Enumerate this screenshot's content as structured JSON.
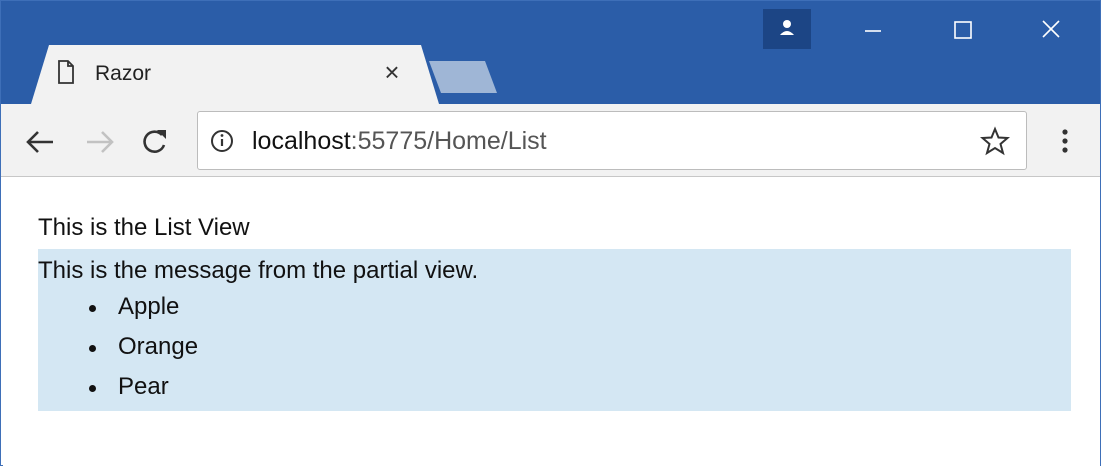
{
  "browser": {
    "tab": {
      "title": "Razor",
      "close_glyph": "×"
    },
    "address": {
      "host": "localhost",
      "rest": ":55775/Home/List"
    },
    "colors": {
      "titlebar": "#2b5da8",
      "toolbar": "#f2f2f2",
      "partial_background": "#d4e7f3"
    }
  },
  "icons": [
    "page-icon",
    "close-icon",
    "new-tab-icon",
    "profile-icon",
    "minimize-icon",
    "maximize-icon",
    "window-close-icon",
    "back-arrow-icon",
    "forward-arrow-icon",
    "reload-icon",
    "info-icon",
    "star-icon",
    "menu-dots-icon"
  ],
  "page": {
    "view_title": "This is the List View",
    "partial_message": "This is the message from the partial view.",
    "items": [
      "Apple",
      "Orange",
      "Pear"
    ]
  }
}
